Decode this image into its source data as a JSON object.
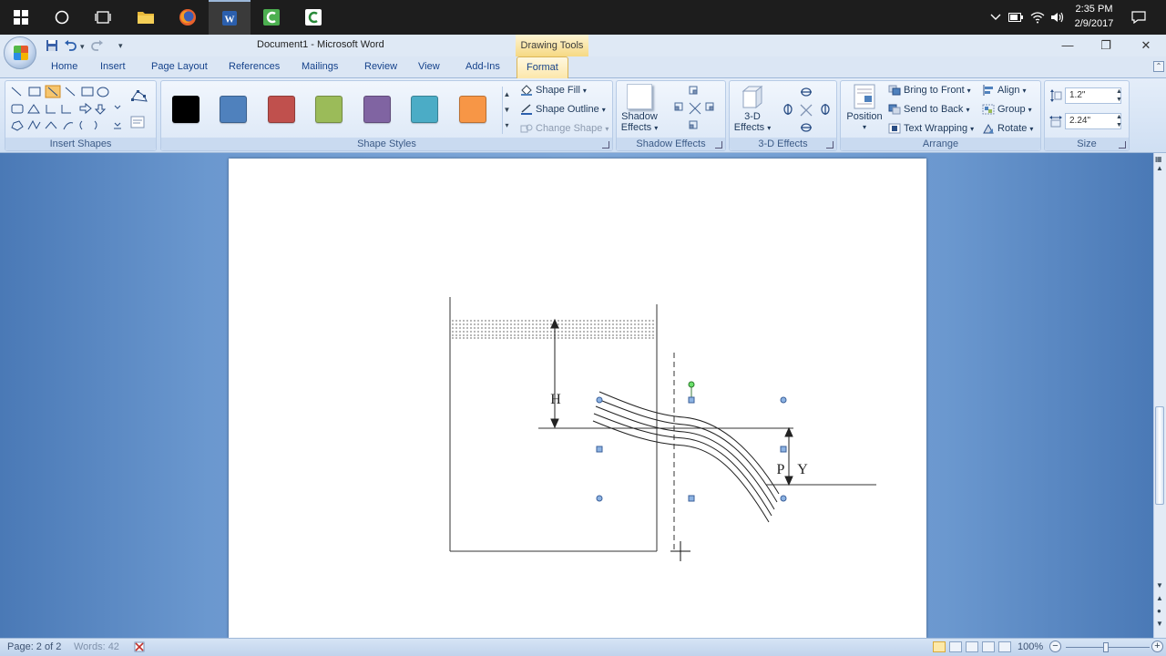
{
  "taskbar": {
    "clock_time": "2:35 PM",
    "clock_date": "2/9/2017",
    "apps": [
      "windows-start",
      "cortana-search",
      "task-view",
      "file-explorer",
      "firefox",
      "microsoft-word",
      "camtasia-recorder",
      "camtasia-studio"
    ]
  },
  "window": {
    "title": "Document1 - Microsoft Word",
    "contextual_tab_title": "Drawing Tools"
  },
  "tabs": [
    "Home",
    "Insert",
    "Page Layout",
    "References",
    "Mailings",
    "Review",
    "View",
    "Add-Ins",
    "Format"
  ],
  "active_tab": "Format",
  "ribbon": {
    "insert_shapes_label": "Insert Shapes",
    "shape_styles": {
      "label": "Shape Styles",
      "swatches": [
        "#000000",
        "#4f81bd",
        "#c0504d",
        "#9bbb59",
        "#8064a2",
        "#4bacc6",
        "#f79646"
      ],
      "shape_fill": "Shape Fill",
      "shape_outline": "Shape Outline",
      "change_shape": "Change Shape"
    },
    "shadow_effects": {
      "label": "Shadow Effects",
      "button_line1": "Shadow",
      "button_line2": "Effects"
    },
    "three_d_effects": {
      "label": "3-D Effects",
      "button_line1": "3-D",
      "button_line2": "Effects"
    },
    "arrange": {
      "label": "Arrange",
      "position": "Position",
      "bring_to_front": "Bring to Front",
      "send_to_back": "Send to Back",
      "text_wrapping": "Text Wrapping",
      "align": "Align",
      "group": "Group",
      "rotate": "Rotate"
    },
    "size": {
      "label": "Size",
      "height": "1.2\"",
      "width": "2.24\""
    }
  },
  "diagram": {
    "label_h": "H",
    "label_p": "P",
    "label_y": "Y"
  },
  "statusbar": {
    "page": "Page: 2 of 2",
    "words": "Words: 42",
    "zoom": "100%"
  }
}
